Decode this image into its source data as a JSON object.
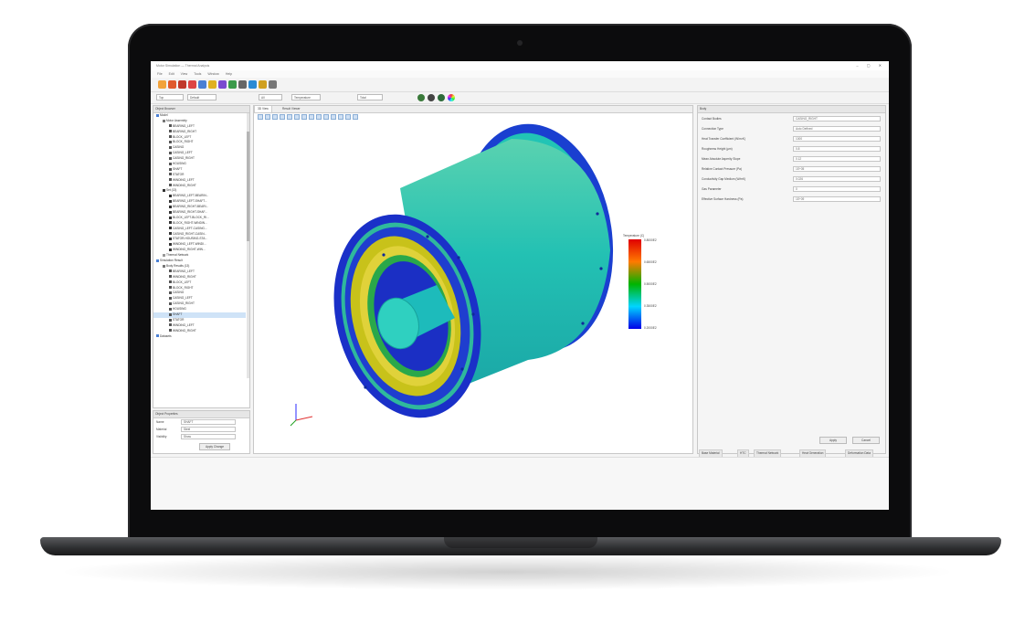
{
  "app": {
    "title": "Motor Simulation — Thermal Analysis",
    "menu": [
      "File",
      "Edit",
      "View",
      "Tools",
      "Window",
      "Help"
    ],
    "window_controls": "– ▢ ✕"
  },
  "toolbar1": {
    "icon_colors": [
      "#f2a23a",
      "#e05a2d",
      "#c0392b",
      "#d44",
      "#4a7fd4",
      "#e0b020",
      "#7a4bd0",
      "#3a9a4a",
      "#666",
      "#2a8ad4",
      "#d0a020",
      "#777"
    ]
  },
  "toolbar2": {
    "dropdowns": [
      "Top",
      "Default",
      "All",
      "Temperature",
      "Total"
    ]
  },
  "left_panel": {
    "title": "Object Browser",
    "tree": [
      {
        "label": "Model",
        "indent": 0,
        "icon": "#4a7fd4"
      },
      {
        "label": "Motor Assembly",
        "indent": 1,
        "icon": "#777"
      },
      {
        "label": "BEARING_LEFT",
        "indent": 2,
        "icon": "#555"
      },
      {
        "label": "BEARING_RIGHT",
        "indent": 2,
        "icon": "#555"
      },
      {
        "label": "BLOCK_LEFT",
        "indent": 2,
        "icon": "#555"
      },
      {
        "label": "BLOCK_RIGHT",
        "indent": 2,
        "icon": "#555"
      },
      {
        "label": "CASING",
        "indent": 2,
        "icon": "#555"
      },
      {
        "label": "CASING_LEFT",
        "indent": 2,
        "icon": "#555"
      },
      {
        "label": "CASING_RIGHT",
        "indent": 2,
        "icon": "#555"
      },
      {
        "label": "HOUSING",
        "indent": 2,
        "icon": "#555"
      },
      {
        "label": "SHAFT",
        "indent": 2,
        "icon": "#555"
      },
      {
        "label": "STATOR",
        "indent": 2,
        "icon": "#555"
      },
      {
        "label": "WINDING_LEFT",
        "indent": 2,
        "icon": "#555"
      },
      {
        "label": "WINDING_RIGHT",
        "indent": 2,
        "icon": "#555"
      },
      {
        "label": "Set (13)",
        "indent": 1,
        "icon": "#333"
      },
      {
        "label": "BEARING_LEFT-BEARIN...",
        "indent": 2,
        "icon": "#333"
      },
      {
        "label": "BEARING_LEFT-SHAFT...",
        "indent": 2,
        "icon": "#333"
      },
      {
        "label": "BEARING_RIGHT-BEARI...",
        "indent": 2,
        "icon": "#333"
      },
      {
        "label": "BEARING_RIGHT-SHAF...",
        "indent": 2,
        "icon": "#333"
      },
      {
        "label": "BLOCK_LEFT-BLOCK_RI...",
        "indent": 2,
        "icon": "#333"
      },
      {
        "label": "BLOCK_RIGHT-WINDIN...",
        "indent": 2,
        "icon": "#333"
      },
      {
        "label": "CASING_LEFT-CASING...",
        "indent": 2,
        "icon": "#333"
      },
      {
        "label": "CASING_RIGHT-CASIN...",
        "indent": 2,
        "icon": "#333"
      },
      {
        "label": "STATOR-HOUSING-STA...",
        "indent": 2,
        "icon": "#333"
      },
      {
        "label": "WINDING_LEFT-WINDI...",
        "indent": 2,
        "icon": "#333"
      },
      {
        "label": "WINDING_RIGHT-WIN...",
        "indent": 2,
        "icon": "#333"
      },
      {
        "label": "Thermal Network",
        "indent": 1,
        "icon": "#999"
      },
      {
        "label": "Simulation Result",
        "indent": 0,
        "icon": "#4a7fd4"
      },
      {
        "label": "Body Results (13)",
        "indent": 1,
        "icon": "#777"
      },
      {
        "label": "BEARING_LEFT",
        "indent": 2,
        "icon": "#555"
      },
      {
        "label": "WINDING_RIGHT",
        "indent": 2,
        "icon": "#555"
      },
      {
        "label": "BLOCK_LEFT",
        "indent": 2,
        "icon": "#555"
      },
      {
        "label": "BLOCK_RIGHT",
        "indent": 2,
        "icon": "#555"
      },
      {
        "label": "CASING",
        "indent": 2,
        "icon": "#555"
      },
      {
        "label": "CASING_LEFT",
        "indent": 2,
        "icon": "#555"
      },
      {
        "label": "CASING_RIGHT",
        "indent": 2,
        "icon": "#555"
      },
      {
        "label": "HOUSING",
        "indent": 2,
        "icon": "#555"
      },
      {
        "label": "SHAFT",
        "indent": 2,
        "icon": "#555",
        "selected": true
      },
      {
        "label": "STATOR",
        "indent": 2,
        "icon": "#555"
      },
      {
        "label": "WINDING_LEFT",
        "indent": 2,
        "icon": "#555"
      },
      {
        "label": "WINDING_RIGHT",
        "indent": 2,
        "icon": "#555"
      },
      {
        "label": "Datasets",
        "indent": 0,
        "icon": "#4a7fd4"
      }
    ]
  },
  "object_properties": {
    "title": "Object Properties",
    "rows": [
      {
        "key": "Name",
        "value": "SHAFT"
      },
      {
        "key": "Material",
        "value": "Steel"
      },
      {
        "key": "Visibility",
        "value": "Show"
      }
    ],
    "button": "Apply Change"
  },
  "viewport": {
    "tabs": [
      "3D View",
      "Result Viewer"
    ],
    "legend": {
      "title": "Temperature (C)",
      "ticks": [
        "0.8000E2",
        "0.6500E2",
        "0.5000E2",
        "0.3500E2",
        "0.2000E2"
      ]
    }
  },
  "right_panel": {
    "title": "Body",
    "props": [
      {
        "key": "Contact Bodies",
        "value": "CASING_RIGHT"
      },
      {
        "key": "Connection Type",
        "value": "Auto Defined"
      },
      {
        "key": "Heat Transfer Coefficient (W/m²K)",
        "value": "1000"
      },
      {
        "key": "Roughness Height (µm)",
        "value": "0.8"
      },
      {
        "key": "Mean Absolute Asperity Slope",
        "value": "0.12"
      },
      {
        "key": "Relative Contact Pressure (Pa)",
        "value": "1E+05"
      },
      {
        "key": "Conductivity Gap Medium (W/mK)",
        "value": "0.026"
      },
      {
        "key": "Gas Parameter",
        "value": "0"
      },
      {
        "key": "Effective Surface Hardness (Pa)",
        "value": "1E+09"
      }
    ],
    "buttons": [
      "Apply",
      "Cancel"
    ],
    "bottom_tabs": [
      "Base Material",
      "HTC",
      "Thermal Network",
      "Heat Generation",
      "Deformation Data"
    ]
  }
}
